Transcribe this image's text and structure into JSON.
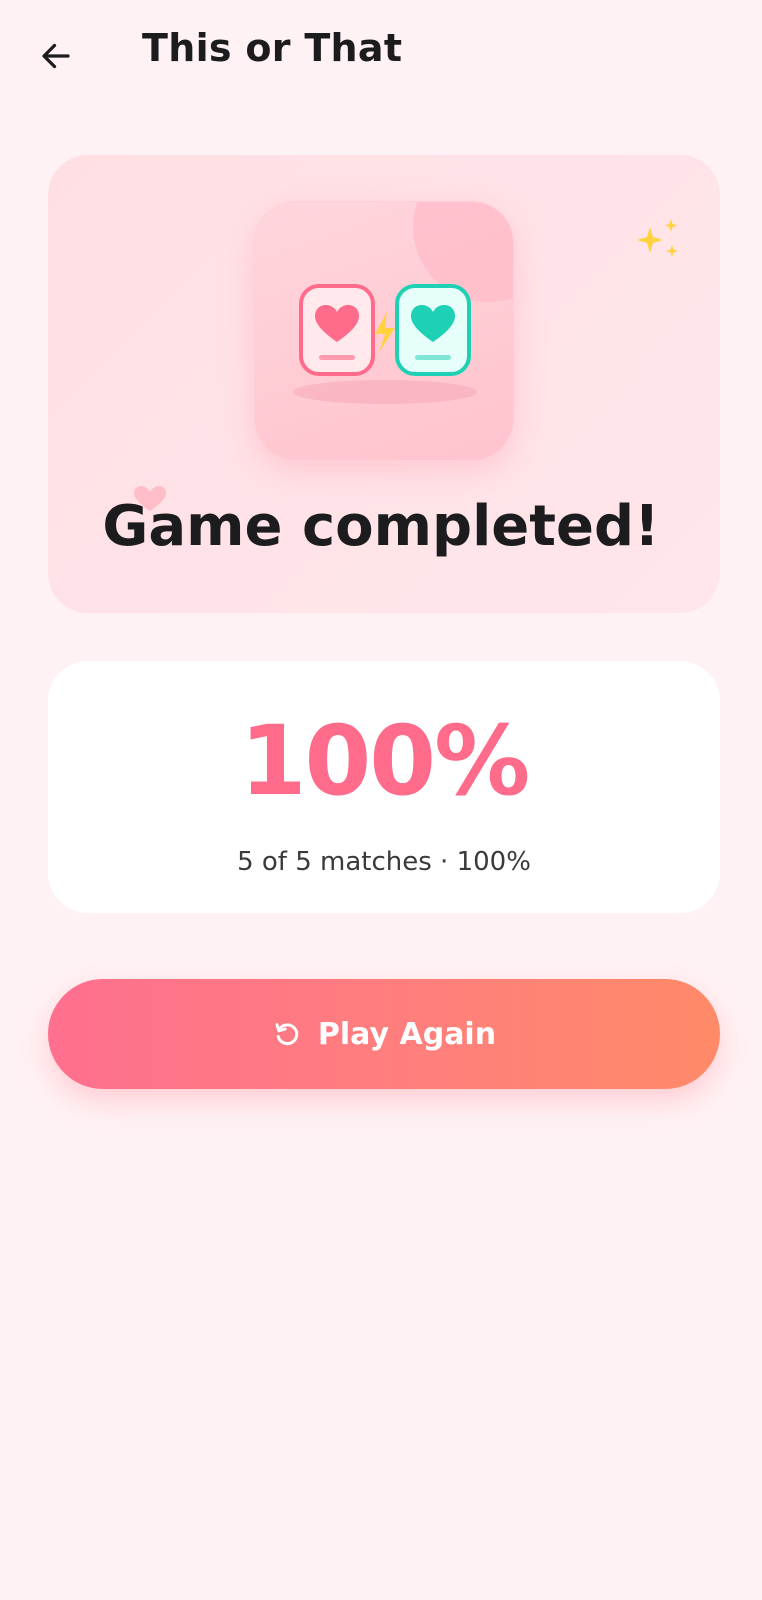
{
  "header": {
    "back_icon": "arrow-left-icon",
    "title": "This or That"
  },
  "hero": {
    "title": "Game completed!",
    "icon": "this-or-that-hearts-icon",
    "decor": [
      "sparkles-icon",
      "small-heart-icon"
    ]
  },
  "score": {
    "value": "100%",
    "subtitle": "5 of 5 matches · 100%"
  },
  "actions": {
    "play_again_label": "Play Again",
    "play_again_icon": "restart-icon"
  },
  "colors": {
    "background": "#fff2f4",
    "accent_pink": "#ff6b8a",
    "accent_teal": "#1fd1b4",
    "button_gradient_start": "#ff6f8f",
    "button_gradient_end": "#ff8a68",
    "sparkle_yellow": "#ffd23f"
  }
}
